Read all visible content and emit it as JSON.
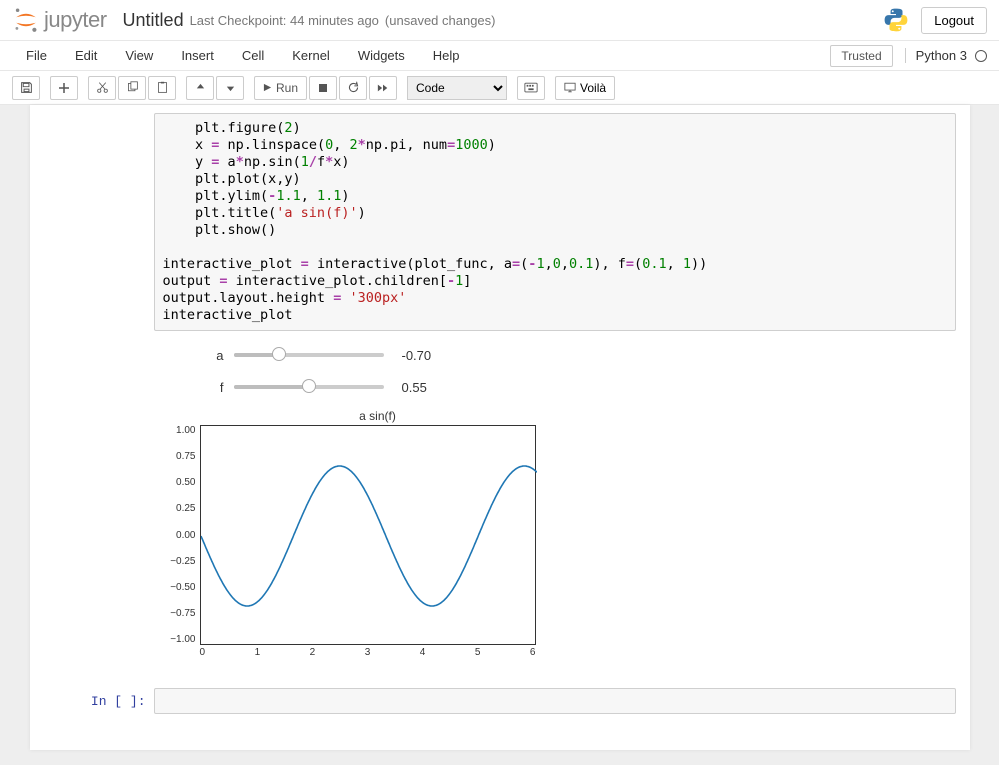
{
  "header": {
    "logo_text": "jupyter",
    "title": "Untitled",
    "checkpoint": "Last Checkpoint: 44 minutes ago",
    "unsaved": "(unsaved changes)",
    "logout": "Logout"
  },
  "menubar": {
    "items": [
      "File",
      "Edit",
      "View",
      "Insert",
      "Cell",
      "Kernel",
      "Widgets",
      "Help"
    ],
    "trusted": "Trusted",
    "kernel": "Python 3"
  },
  "toolbar": {
    "run_label": "Run",
    "cell_type": "Code",
    "voila": "Voilà"
  },
  "code_cell": {
    "lines": [
      {
        "indent": 1,
        "tokens": [
          {
            "t": "id",
            "v": "plt.figure("
          },
          {
            "t": "num",
            "v": "2"
          },
          {
            "t": "id",
            "v": ")"
          }
        ]
      },
      {
        "indent": 1,
        "tokens": [
          {
            "t": "id",
            "v": "x "
          },
          {
            "t": "op",
            "v": "="
          },
          {
            "t": "id",
            "v": " np.linspace("
          },
          {
            "t": "num",
            "v": "0"
          },
          {
            "t": "id",
            "v": ", "
          },
          {
            "t": "num",
            "v": "2"
          },
          {
            "t": "op",
            "v": "*"
          },
          {
            "t": "id",
            "v": "np.pi, num"
          },
          {
            "t": "op",
            "v": "="
          },
          {
            "t": "num",
            "v": "1000"
          },
          {
            "t": "id",
            "v": ")"
          }
        ]
      },
      {
        "indent": 1,
        "tokens": [
          {
            "t": "id",
            "v": "y "
          },
          {
            "t": "op",
            "v": "="
          },
          {
            "t": "id",
            "v": " a"
          },
          {
            "t": "op",
            "v": "*"
          },
          {
            "t": "id",
            "v": "np.sin("
          },
          {
            "t": "num",
            "v": "1"
          },
          {
            "t": "op",
            "v": "/"
          },
          {
            "t": "id",
            "v": "f"
          },
          {
            "t": "op",
            "v": "*"
          },
          {
            "t": "id",
            "v": "x)"
          }
        ]
      },
      {
        "indent": 1,
        "tokens": [
          {
            "t": "id",
            "v": "plt.plot(x,y)"
          }
        ]
      },
      {
        "indent": 1,
        "tokens": [
          {
            "t": "id",
            "v": "plt.ylim("
          },
          {
            "t": "op",
            "v": "-"
          },
          {
            "t": "num",
            "v": "1.1"
          },
          {
            "t": "id",
            "v": ", "
          },
          {
            "t": "num",
            "v": "1.1"
          },
          {
            "t": "id",
            "v": ")"
          }
        ]
      },
      {
        "indent": 1,
        "tokens": [
          {
            "t": "id",
            "v": "plt.title("
          },
          {
            "t": "str",
            "v": "'a sin(f)'"
          },
          {
            "t": "id",
            "v": ")"
          }
        ]
      },
      {
        "indent": 1,
        "tokens": [
          {
            "t": "id",
            "v": "plt.show()"
          }
        ]
      },
      {
        "indent": 0,
        "tokens": [
          {
            "t": "id",
            "v": ""
          }
        ]
      },
      {
        "indent": 0,
        "tokens": [
          {
            "t": "id",
            "v": "interactive_plot "
          },
          {
            "t": "op",
            "v": "="
          },
          {
            "t": "id",
            "v": " interactive(plot_func, a"
          },
          {
            "t": "op",
            "v": "="
          },
          {
            "t": "id",
            "v": "("
          },
          {
            "t": "op",
            "v": "-"
          },
          {
            "t": "num",
            "v": "1"
          },
          {
            "t": "id",
            "v": ","
          },
          {
            "t": "num",
            "v": "0"
          },
          {
            "t": "id",
            "v": ","
          },
          {
            "t": "num",
            "v": "0.1"
          },
          {
            "t": "id",
            "v": "), f"
          },
          {
            "t": "op",
            "v": "="
          },
          {
            "t": "id",
            "v": "("
          },
          {
            "t": "num",
            "v": "0.1"
          },
          {
            "t": "id",
            "v": ", "
          },
          {
            "t": "num",
            "v": "1"
          },
          {
            "t": "id",
            "v": "))"
          }
        ]
      },
      {
        "indent": 0,
        "tokens": [
          {
            "t": "id",
            "v": "output "
          },
          {
            "t": "op",
            "v": "="
          },
          {
            "t": "id",
            "v": " interactive_plot.children["
          },
          {
            "t": "op",
            "v": "-"
          },
          {
            "t": "num",
            "v": "1"
          },
          {
            "t": "id",
            "v": "]"
          }
        ]
      },
      {
        "indent": 0,
        "tokens": [
          {
            "t": "id",
            "v": "output.layout.height "
          },
          {
            "t": "op",
            "v": "="
          },
          {
            "t": "id",
            "v": " "
          },
          {
            "t": "str",
            "v": "'300px'"
          }
        ]
      },
      {
        "indent": 0,
        "tokens": [
          {
            "t": "id",
            "v": "interactive_plot"
          }
        ]
      }
    ]
  },
  "widgets": {
    "a": {
      "label": "a",
      "value": "-0.70",
      "min": -1,
      "max": 0,
      "pos_pct": 30
    },
    "f": {
      "label": "f",
      "value": "0.55",
      "min": 0.1,
      "max": 1,
      "pos_pct": 50
    }
  },
  "chart_data": {
    "type": "line",
    "title": "a sin(f)",
    "xlabel": "",
    "ylabel": "",
    "xlim": [
      0,
      6.283185
    ],
    "ylim": [
      -1.1,
      1.1
    ],
    "xticks": [
      "0",
      "1",
      "2",
      "3",
      "4",
      "5",
      "6"
    ],
    "yticks": [
      "1.00",
      "0.75",
      "0.50",
      "0.25",
      "0.00",
      "−0.25",
      "−0.50",
      "−0.75",
      "−1.00"
    ],
    "series": [
      {
        "name": "a*sin(x/f)",
        "params": {
          "a": -0.7,
          "f": 0.55
        },
        "x": [
          0.0,
          0.31,
          0.63,
          0.94,
          1.26,
          1.57,
          1.88,
          2.2,
          2.51,
          2.83,
          3.14,
          3.46,
          3.77,
          4.08,
          4.4,
          4.71,
          5.03,
          5.34,
          5.65,
          5.97,
          6.28
        ],
        "y": [
          0.0,
          -0.376,
          -0.637,
          -0.7,
          -0.548,
          -0.229,
          0.169,
          0.511,
          0.693,
          0.663,
          0.438,
          0.101,
          -0.263,
          -0.553,
          -0.698,
          -0.653,
          -0.418,
          -0.078,
          0.285,
          0.568,
          0.7
        ]
      }
    ]
  },
  "prompt_empty": "In [ ]:"
}
